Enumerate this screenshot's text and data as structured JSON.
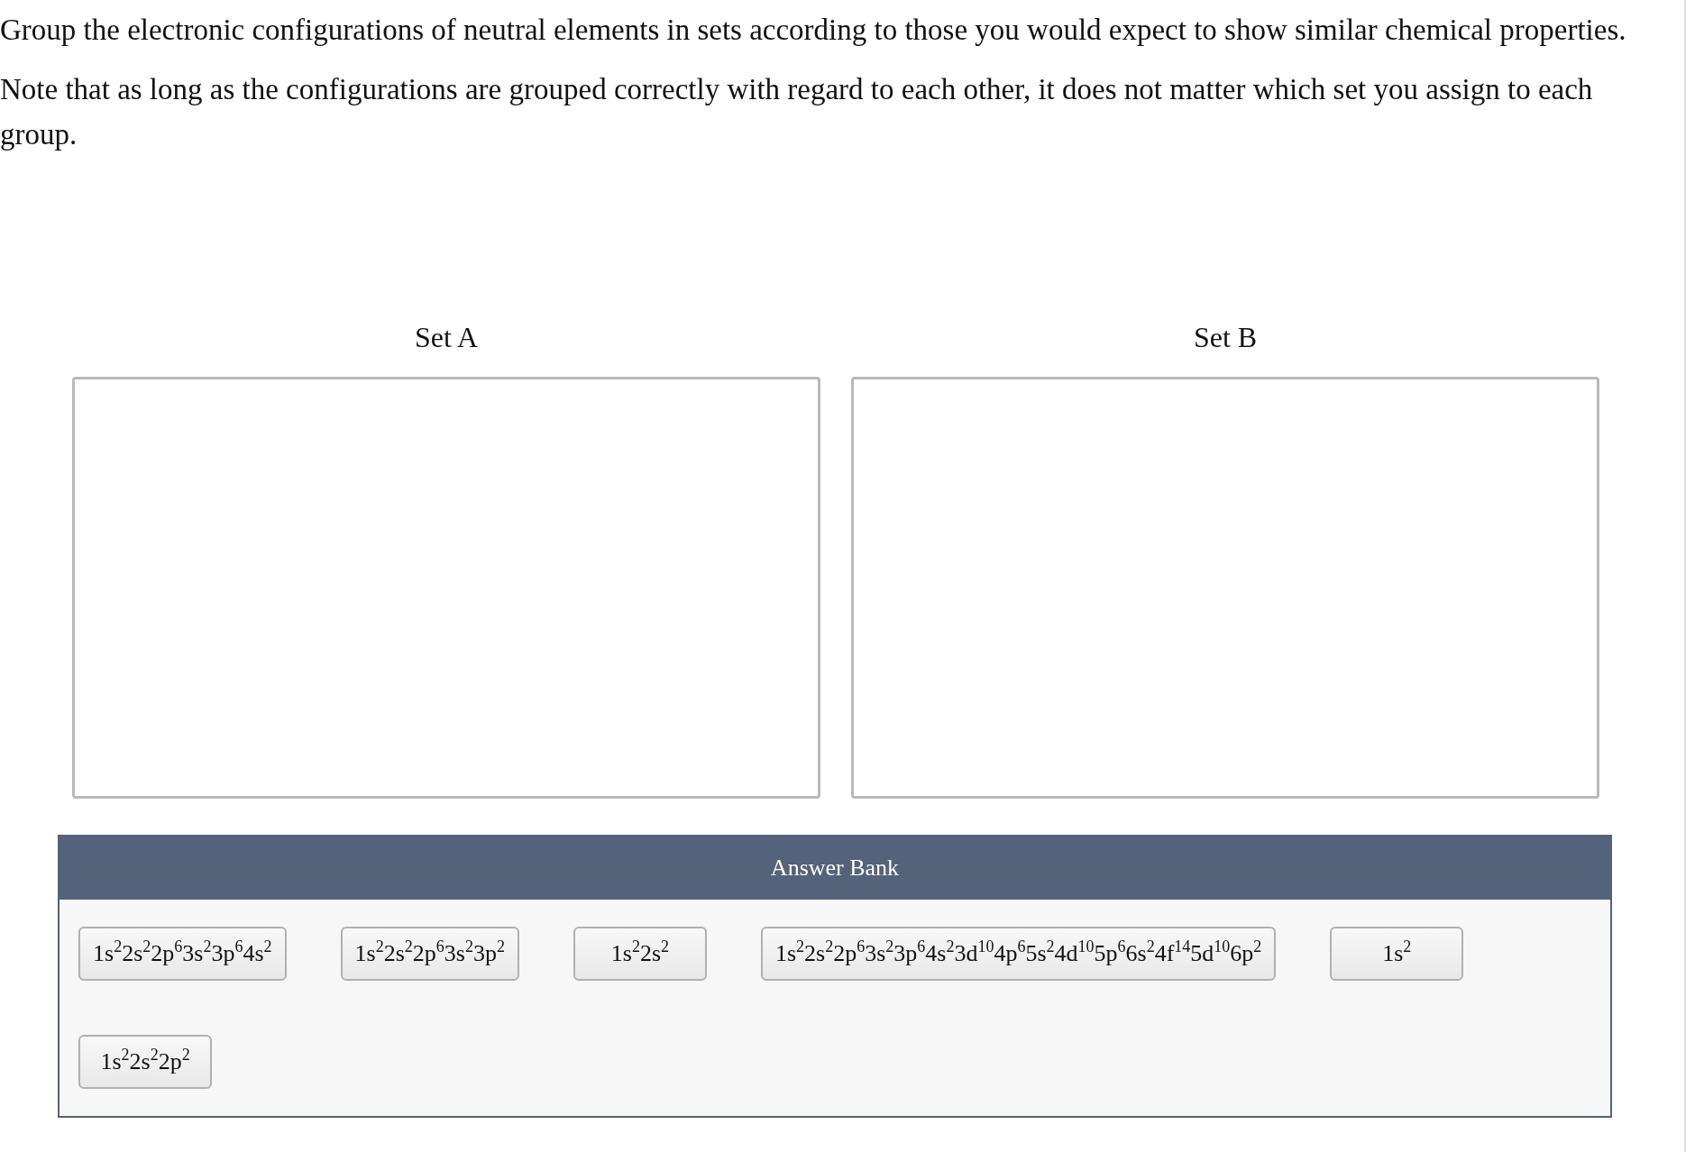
{
  "instructions": [
    "Group the electronic configurations of neutral elements in sets according to those you would expect to show similar chemical properties.",
    "Note that as long as the configurations are grouped correctly with regard to each other, it does not matter which set you assign to each group."
  ],
  "sets": [
    {
      "label": "Set A"
    },
    {
      "label": "Set B"
    }
  ],
  "answer_bank": {
    "title": "Answer Bank",
    "items": [
      "1s$^{2}$2s$^{2}$2p$^{6}$3s$^{2}$3p$^{6}$4s$^{2}$",
      "1s$^{2}$2s$^{2}$2p$^{6}$3s$^{2}$3p$^{2}$",
      "1s$^{2}$2s$^{2}$",
      "1s$^{2}$2s$^{2}$2p$^{6}$3s$^{2}$3p$^{6}$4s$^{2}$3d$^{10}$4p$^{6}$5s$^{2}$4d$^{10}$5p$^{6}$6s$^{2}$4f$^{14}$5d$^{10}$6p$^{2}$",
      "1s$^{2}$",
      "1s$^{2}$2s$^{2}$2p$^{2}$"
    ]
  }
}
